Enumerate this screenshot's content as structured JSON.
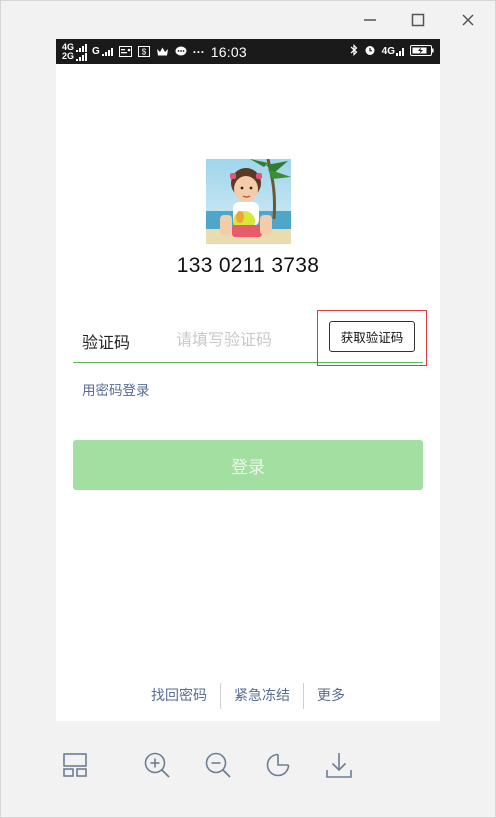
{
  "status_bar": {
    "network_1": "4G",
    "network_2": "2G",
    "network_3": "G",
    "icon_1": "id-card-icon",
    "icon_2": "dollar-box-icon",
    "icon_3": "crown-icon",
    "icon_4": "chat-bubble-icon",
    "more": "···",
    "time": "16:03",
    "bluetooth_icon": "bluetooth-icon",
    "alarm_icon": "alarm-icon",
    "network_right": "4G",
    "battery_icon": "battery-icon"
  },
  "window_controls": {
    "minimize_icon": "minimize-icon",
    "maximize_icon": "maximize-icon",
    "close_icon": "close-icon"
  },
  "login": {
    "phone_number": "133 0211 3738",
    "code_label": "验证码",
    "code_placeholder": "请填写验证码",
    "get_code_button": "获取验证码",
    "password_login_link": "用密码登录",
    "login_button": "登录"
  },
  "footer": {
    "links": [
      "找回密码",
      "紧急冻结",
      "更多"
    ]
  },
  "toolbar": {
    "icons": [
      "layout-icon",
      "zoom-in-icon",
      "zoom-out-icon",
      "rotate-icon",
      "download-icon"
    ]
  },
  "colors": {
    "accent_green": "#a3dfa1",
    "underline_green": "#5cb85c",
    "link_blue": "#576b95",
    "highlight_red": "#e0393e"
  }
}
